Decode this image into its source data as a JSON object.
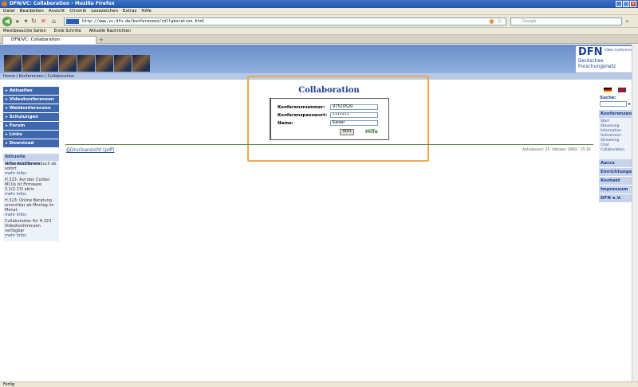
{
  "window": {
    "title": "DFN/VC: Collaboration - Mozilla Firefox"
  },
  "menu": [
    "Datei",
    "Bearbeiten",
    "Ansicht",
    "Chronik",
    "Lesezeichen",
    "Extras",
    "Hilfe"
  ],
  "nav": {
    "url": "http://www.vc.dfn.de/konferenzen/collaboration.html",
    "search_placeholder": "Google"
  },
  "bookmarks": [
    "Meistbesuchte Seiten",
    "Erste Schritte",
    "Aktuelle Nachrichten"
  ],
  "tab": {
    "label": "DFN/VC: Collaboration"
  },
  "logo": {
    "main": "DFN",
    "sub": "Video Conference",
    "line1": "Deutsches",
    "line2": "Forschungsnetz"
  },
  "breadcrumb": "Home / Konferenzen / Collaboration",
  "sidebar": {
    "items": [
      "Aktuelles",
      "Videokonferenzen",
      "Webkonferenzen",
      "Schulungen",
      "Forum",
      "Links",
      "Download"
    ]
  },
  "info": {
    "title": "Aktuelle Informationen",
    "items": [
      {
        "text": "MCUs ACU/Terminbuch ab sofort",
        "more": "mehr Infos"
      },
      {
        "text": "H.323: Auf den Codian MCUs ist Firmware 3.1(2.13) aktiv",
        "more": "mehr Infos"
      },
      {
        "text": "H.323: Online Beratung erreichbar ab Montag im Monat",
        "more": "mehr Infos"
      },
      {
        "text": "Collaboration für H.323 Videokonferenzen verfügbar",
        "more": "mehr Infos"
      }
    ]
  },
  "main": {
    "title": "Collaboration",
    "form": {
      "conf_number_label": "Konferenznummer:",
      "conf_number_value": "97520520",
      "password_label": "Konferenzpasswort:",
      "password_value": "•••••••",
      "name_label": "Name:",
      "name_value": "Kaiser",
      "start_label": "Start",
      "help_label": "Hilfe"
    },
    "print_link": "Druckansicht (pdf)",
    "updated": "Aktualisiert: 25. Oktober 2009 - 15:10"
  },
  "right": {
    "search_label": "Suche:",
    "search_go": "▸",
    "konferenzen": "Konferenzen",
    "sub_items": [
      "Start",
      "Steuerung",
      "Information",
      "Aufnahmen",
      "Streaming",
      "Chat",
      "Collaboration"
    ],
    "sections": [
      "Aaccs",
      "Einrichtungen",
      "Kontakt",
      "Impressum",
      "DFN e.V."
    ]
  },
  "status": "Fertig"
}
